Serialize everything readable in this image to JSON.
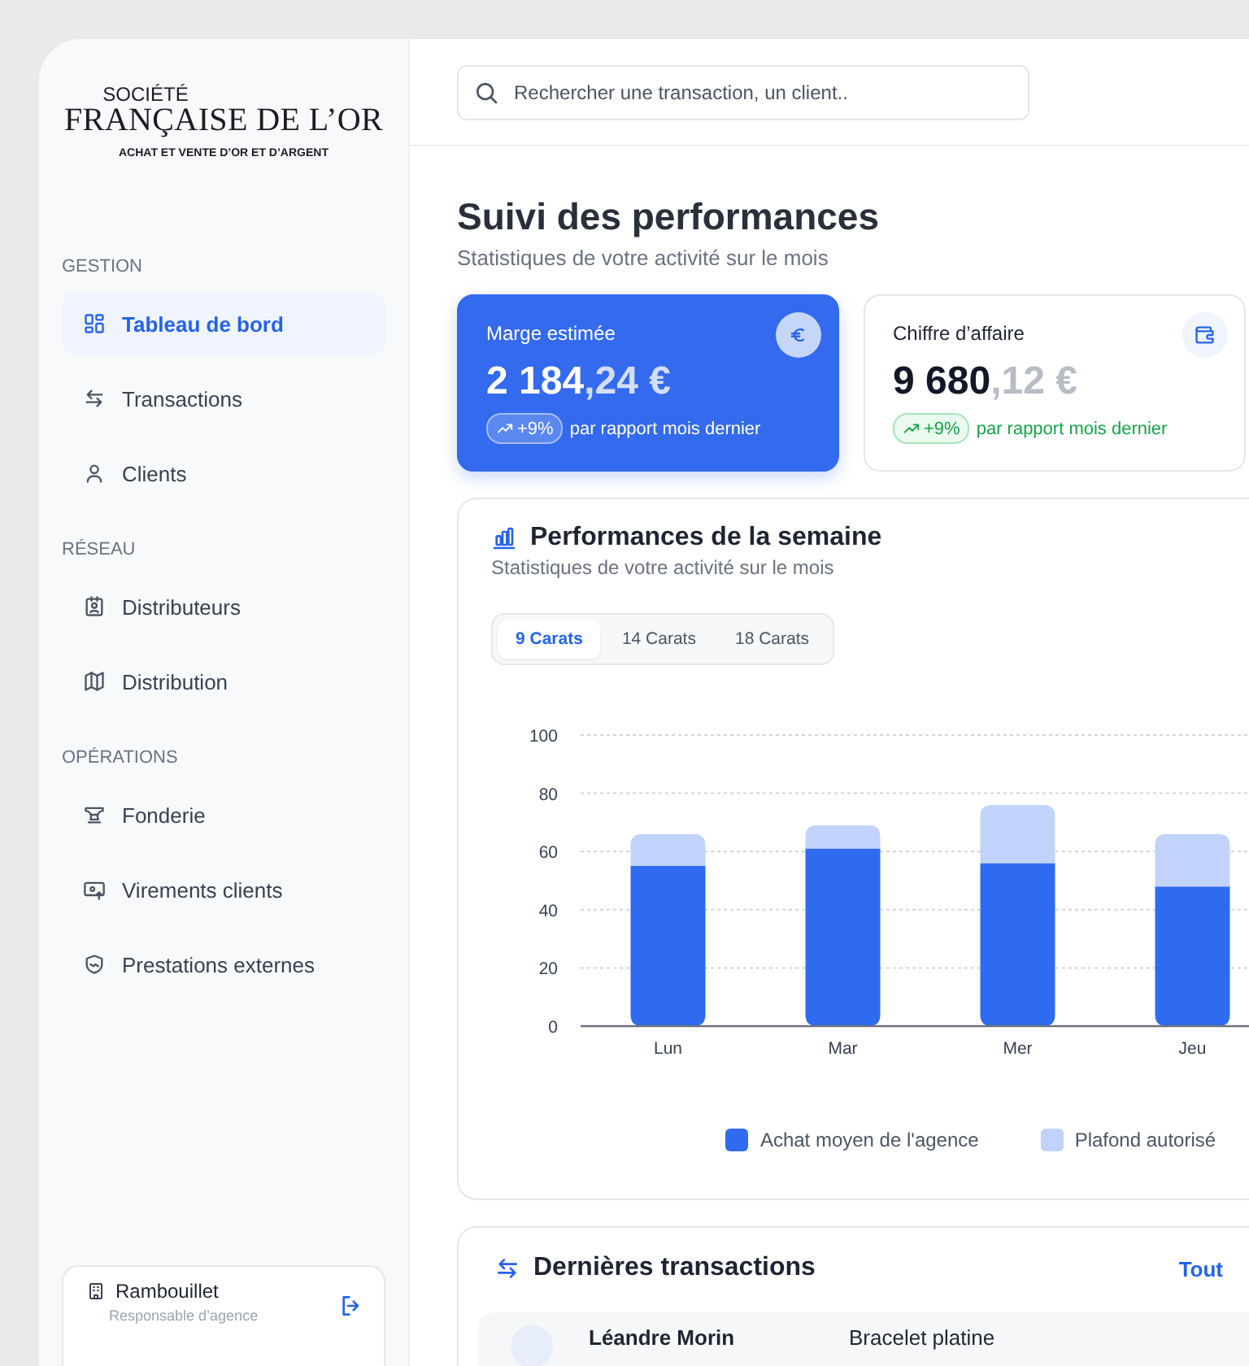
{
  "brand": {
    "line_1": "SOCIÉTÉ",
    "line_2": "FRANÇAISE DE L’OR",
    "tagline": "ACHAT ET VENTE D’OR ET D’ARGENT"
  },
  "sidebar": {
    "sections": [
      {
        "title": "GESTION",
        "items": [
          {
            "label": "Tableau de bord",
            "selected": true
          },
          {
            "label": "Transactions",
            "selected": false
          },
          {
            "label": "Clients",
            "selected": false
          }
        ]
      },
      {
        "title": "RÉSEAU",
        "items": [
          {
            "label": "Distributeurs",
            "selected": false
          },
          {
            "label": "Distribution",
            "selected": false
          }
        ]
      },
      {
        "title": "OPÉRATIONS",
        "items": [
          {
            "label": "Fonderie",
            "selected": false
          },
          {
            "label": "Virements clients",
            "selected": false
          },
          {
            "label": "Prestations externes",
            "selected": false
          }
        ]
      }
    ]
  },
  "agency": {
    "name": "Rambouillet",
    "role": "Responsable d’agence"
  },
  "search": {
    "placeholder": "Rechercher une transaction, un client.."
  },
  "page": {
    "title": "Suivi des performances",
    "subtitle": "Statistiques de votre activité sur le mois"
  },
  "stats": [
    {
      "label": "Marge estimée",
      "value_main": "2 184",
      "value_decimals": ",24 €",
      "change": "+9%",
      "note": "par rapport mois dernier",
      "highlighted": true
    },
    {
      "label": "Chiffre d’affaire",
      "value_main": "9 680",
      "value_decimals": ",12 €",
      "change": "+9%",
      "note": "par rapport mois dernier",
      "highlighted": false
    }
  ],
  "performance": {
    "title": "Performances de la semaine",
    "subtitle": "Statistiques de votre activité sur le mois",
    "tabs": [
      {
        "label": "9 Carats",
        "selected": true
      },
      {
        "label": "14 Carats",
        "selected": false
      },
      {
        "label": "18 Carats",
        "selected": false
      }
    ],
    "chart_data": {
      "type": "bar",
      "categories": [
        "Lun",
        "Mar",
        "Mer",
        "Jeu"
      ],
      "stacked": true,
      "grid": true,
      "ylim": [
        0,
        100
      ],
      "yticks": [
        0,
        20,
        40,
        60,
        80,
        100
      ],
      "series": [
        {
          "name": "Achat moyen de l'agence",
          "color": "#2f6bef",
          "values": [
            55,
            61,
            56,
            48
          ]
        },
        {
          "name": "Plafond autorisé",
          "color": "#c2d3fb",
          "values": [
            11,
            8,
            20,
            18
          ]
        }
      ]
    }
  },
  "transactions": {
    "title": "Dernières transactions",
    "link": "Tout",
    "rows": [
      {
        "client": "Léandre Morin",
        "product": "Bracelet platine"
      }
    ]
  }
}
